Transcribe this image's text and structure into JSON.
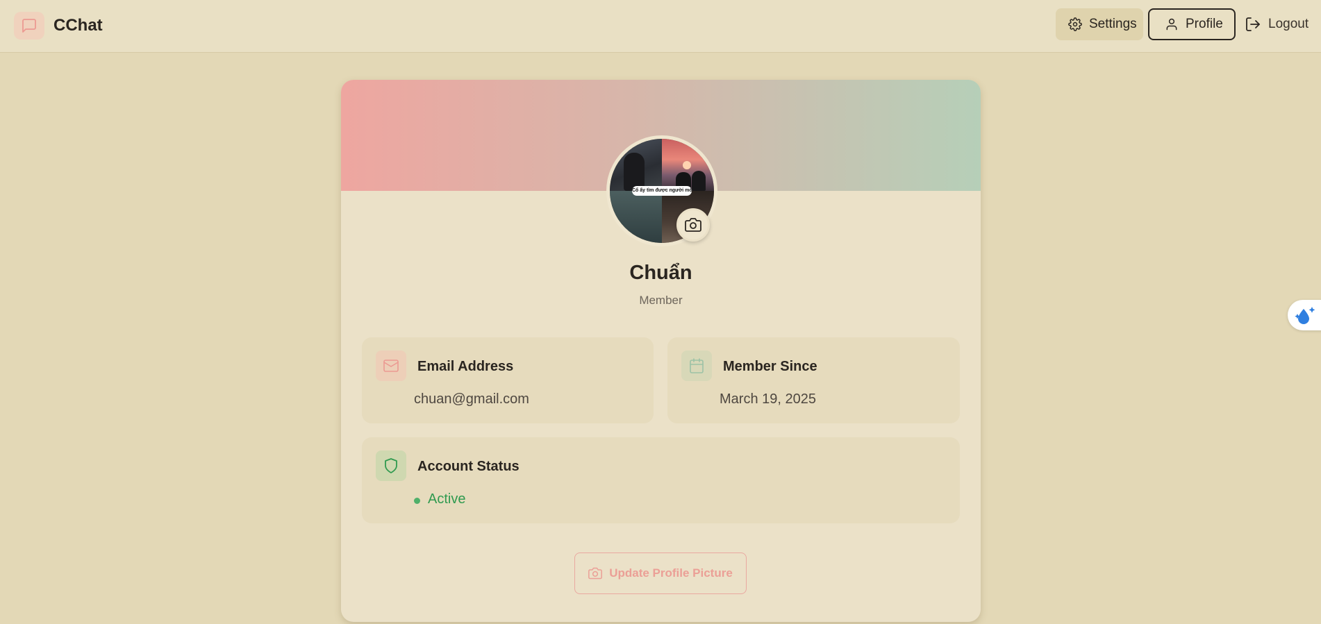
{
  "header": {
    "app_name": "CChat",
    "settings_label": "Settings",
    "profile_label": "Profile",
    "logout_label": "Logout"
  },
  "profile": {
    "avatar_caption": "Cổ ấy tìm được người mới",
    "name": "Chuẩn",
    "role": "Member",
    "email": {
      "title": "Email Address",
      "value": "chuan@gmail.com"
    },
    "member_since": {
      "title": "Member Since",
      "value": "March 19, 2025"
    },
    "account_status": {
      "title": "Account Status",
      "value": "Active"
    },
    "update_button_label": "Update Profile Picture"
  },
  "colors": {
    "background": "#e3d8b6",
    "card": "#ebe1c8",
    "banner_start": "#eea6a0",
    "banner_end": "#b6cfb8",
    "accent_pink": "#eb9f96",
    "status_green": "#2f9a4f"
  },
  "icons": {
    "brand": "message-square-icon",
    "settings": "gear-icon",
    "profile": "user-icon",
    "logout": "logout-icon",
    "camera": "camera-icon",
    "email": "mail-icon",
    "calendar": "calendar-icon",
    "status": "shield-icon",
    "extension": "droplet-sparkle-icon"
  }
}
